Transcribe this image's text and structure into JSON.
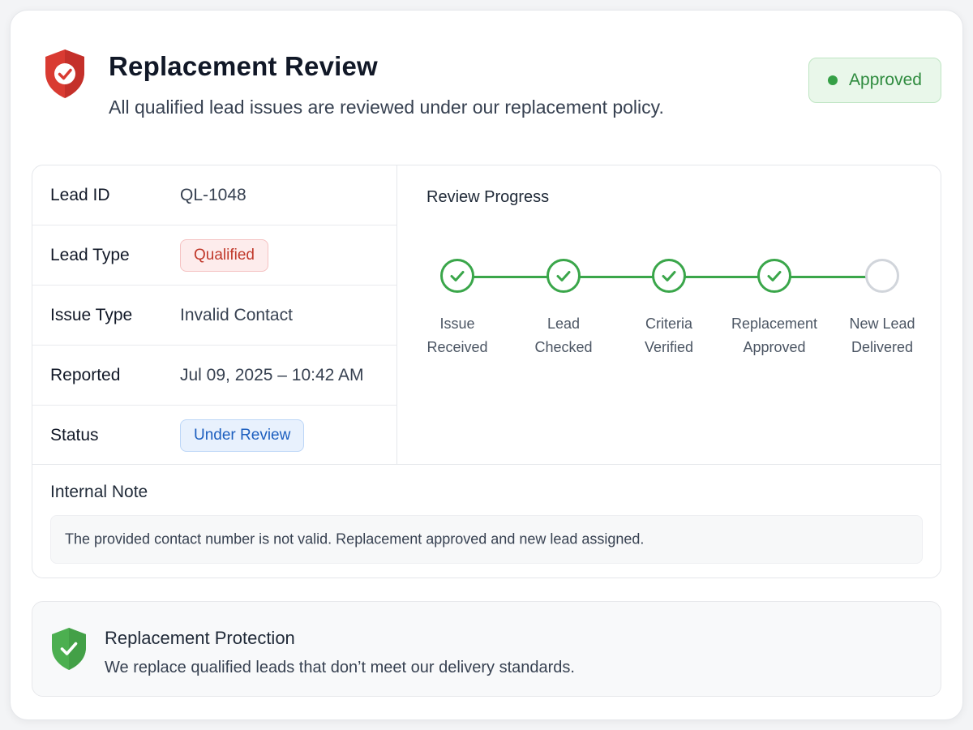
{
  "header": {
    "title": "Replacement Review",
    "subtitle": "All qualified lead issues are reviewed under our replacement policy.",
    "status_badge": "Approved",
    "colors": {
      "shield": "#d93b32",
      "badge_text": "#2e8b3e",
      "badge_bg": "#e9f7ea"
    }
  },
  "details": {
    "rows": [
      {
        "label": "Lead ID",
        "value": "QL-1048"
      },
      {
        "label": "Lead Type",
        "value": "Qualified"
      },
      {
        "label": "Issue Type",
        "value": "Invalid Contact"
      },
      {
        "label": "Reported",
        "value": "Jul 09, 2025 – 10:42 AM"
      },
      {
        "label": "Status",
        "value": "Under Review"
      }
    ]
  },
  "progress": {
    "title": "Review Progress",
    "steps": [
      {
        "label": "Issue\nReceived",
        "state": "done"
      },
      {
        "label": "Lead\nChecked",
        "state": "done"
      },
      {
        "label": "Criteria\nVerified",
        "state": "done"
      },
      {
        "label": "Replacement\nApproved",
        "state": "done"
      },
      {
        "label": "New Lead\nDelivered",
        "state": "pending"
      }
    ]
  },
  "note": {
    "title": "Internal Note",
    "text": "The provided contact number is not valid. Replacement approved and new lead assigned."
  },
  "protection": {
    "title": "Replacement Protection",
    "text": "We replace qualified leads that don’t meet our delivery standards."
  }
}
